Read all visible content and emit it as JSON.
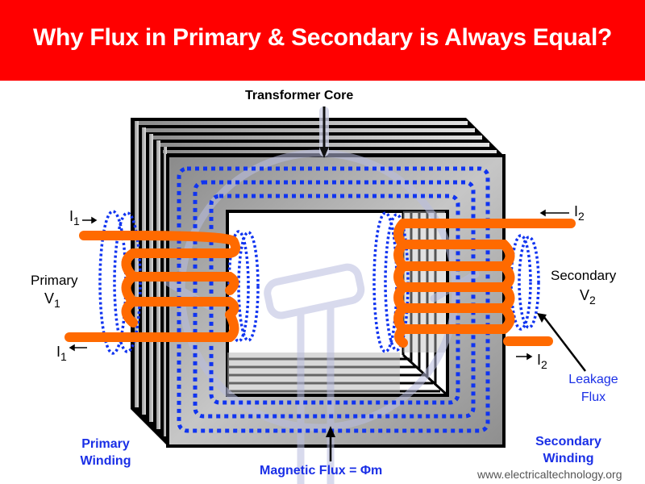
{
  "header": {
    "title": "Why Flux in Primary & Secondary is Always Equal?",
    "background_color": "#ff0000"
  },
  "diagram": {
    "core_label": "Transformer Core",
    "primary": {
      "label": "Primary",
      "voltage_symbol": "V",
      "voltage_subscript": "1",
      "current_symbol": "I",
      "current_subscript": "1",
      "winding_label_line1": "Primary",
      "winding_label_line2": "Winding"
    },
    "secondary": {
      "label": "Secondary",
      "voltage_symbol": "V",
      "voltage_subscript": "2",
      "current_symbol": "I",
      "current_subscript": "2",
      "winding_label_line1": "Secondary",
      "winding_label_line2": "Winding"
    },
    "leakage_flux_line1": "Leakage",
    "leakage_flux_line2": "Flux",
    "magnetic_flux_label": "Magnetic Flux = Φm",
    "colors": {
      "winding": "#ff6a00",
      "flux": "#1034f0",
      "label_blue": "#1a2fe6"
    }
  },
  "footer": {
    "website": "www.electricaltechnology.org"
  }
}
